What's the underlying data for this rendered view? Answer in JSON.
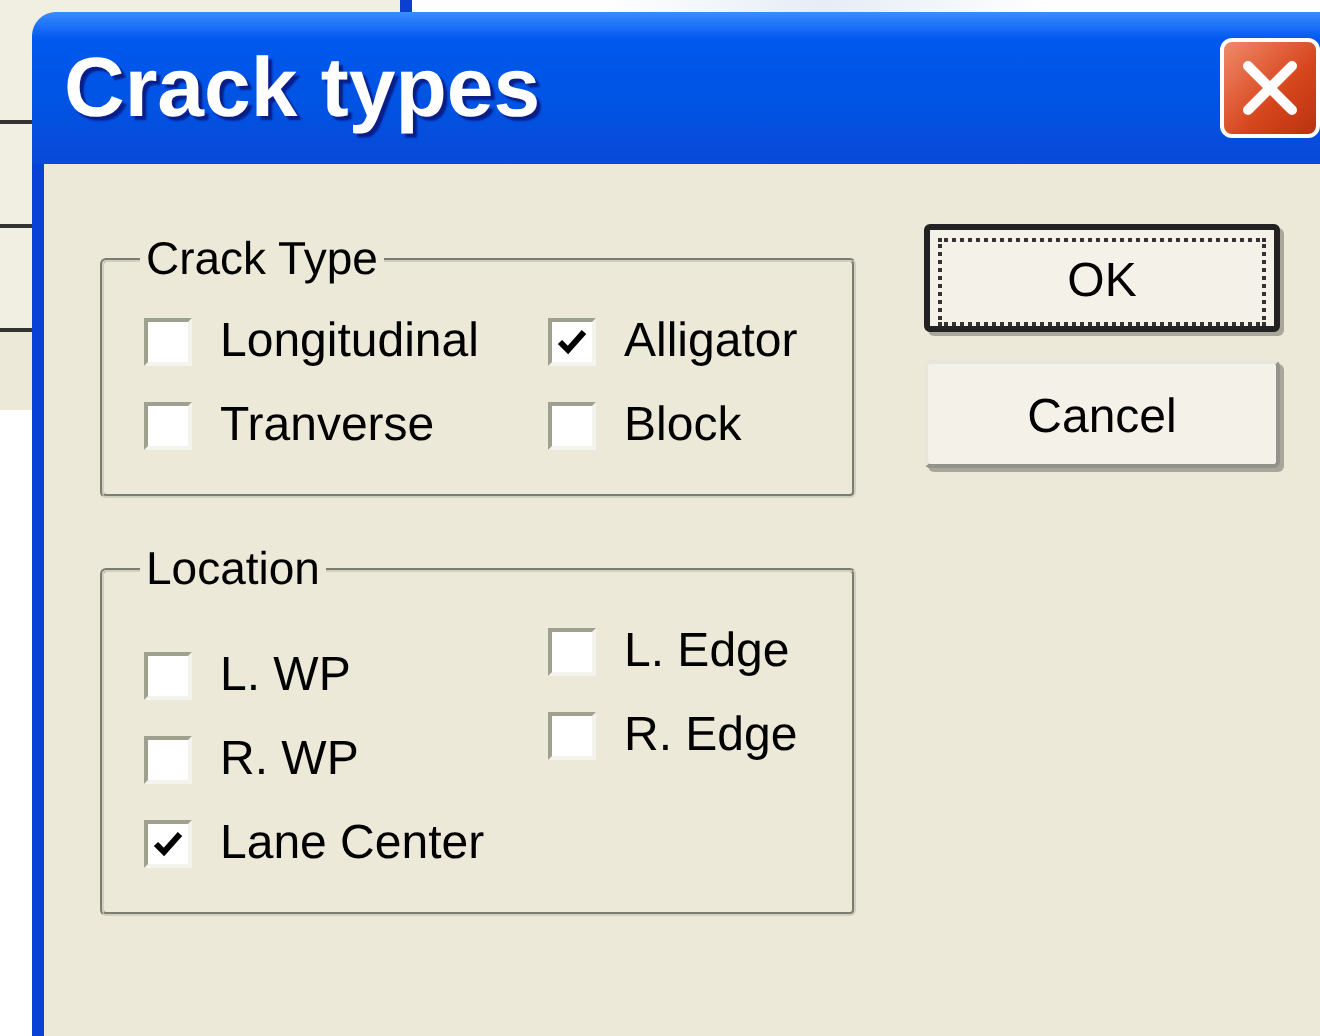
{
  "window": {
    "title": "Crack types"
  },
  "groups": [
    {
      "title": "Crack Type",
      "columns": [
        [
          {
            "label": "Longitudinal",
            "checked": false
          },
          {
            "label": "Tranverse",
            "checked": false
          }
        ],
        [
          {
            "label": "Alligator",
            "checked": true
          },
          {
            "label": "Block",
            "checked": false
          }
        ]
      ]
    },
    {
      "title": "Location",
      "columns": [
        [
          {
            "label": "L. WP",
            "checked": false
          },
          {
            "label": "R. WP",
            "checked": false
          },
          {
            "label": "Lane Center",
            "checked": true
          }
        ],
        [
          {
            "label": "L. Edge",
            "checked": false
          },
          {
            "label": "R. Edge",
            "checked": false
          }
        ]
      ]
    }
  ],
  "buttons": [
    {
      "label": "OK",
      "default": true
    },
    {
      "label": "Cancel",
      "default": false
    }
  ]
}
